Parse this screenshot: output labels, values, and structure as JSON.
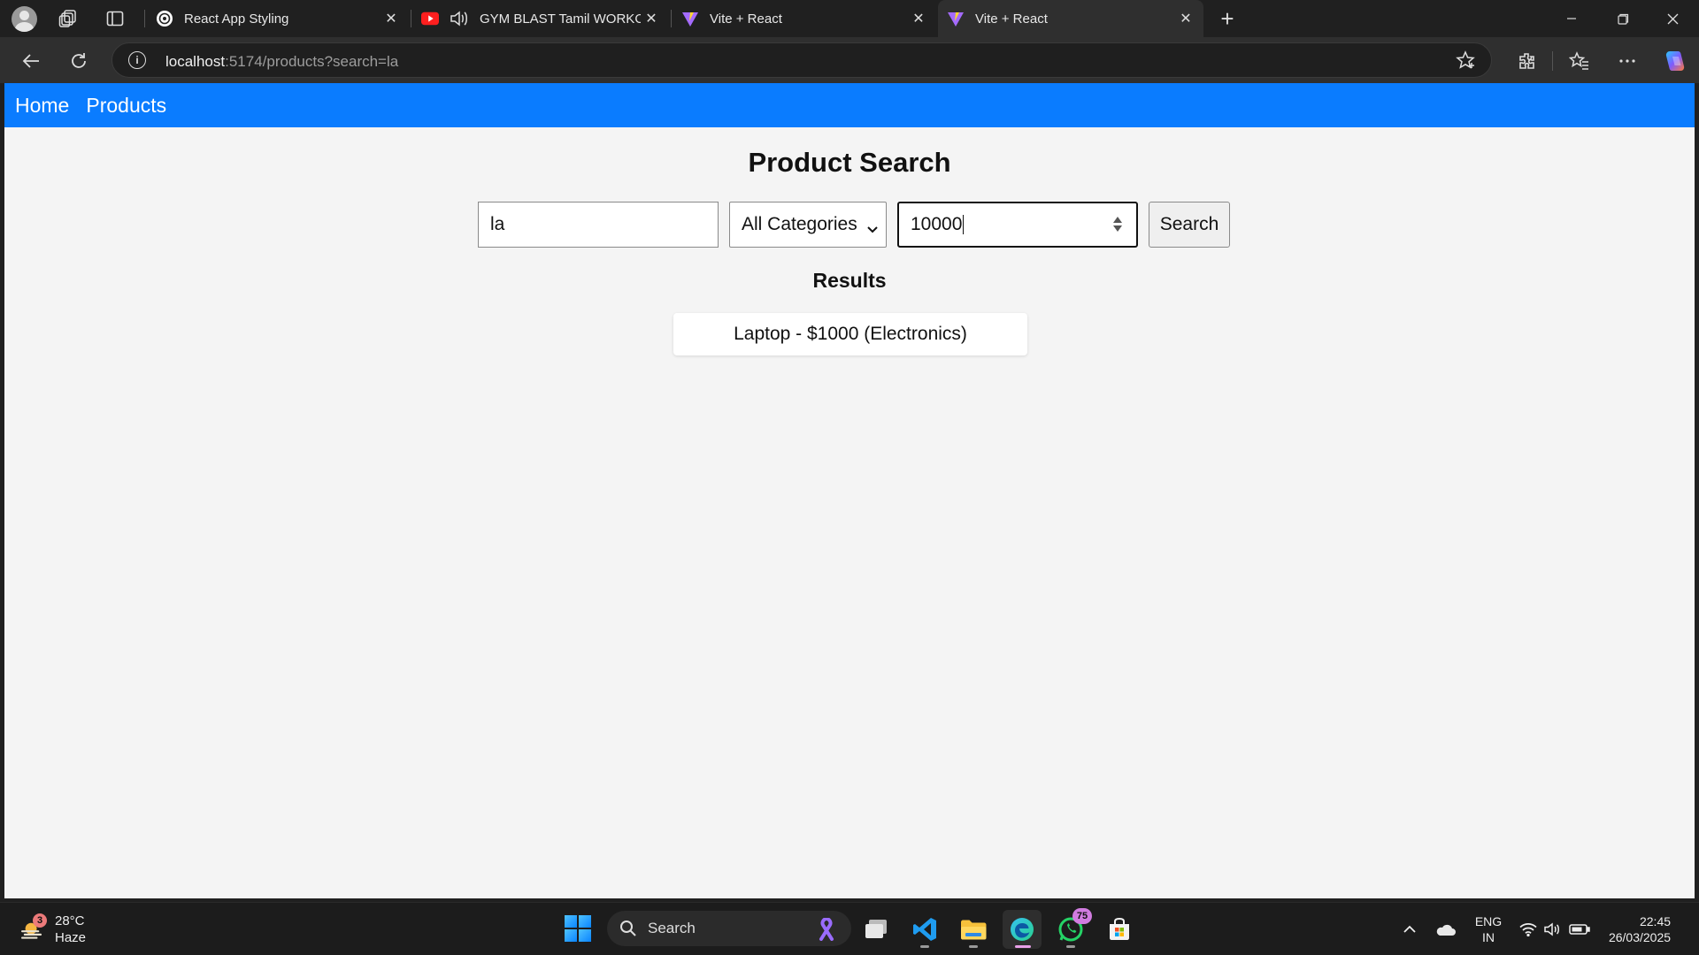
{
  "browser": {
    "tabs": [
      {
        "title": "React App Styling",
        "favicon": "openai-icon",
        "active": false
      },
      {
        "title": "GYM BLAST Tamil WORKOUT",
        "favicon": "youtube-icon",
        "audio": true,
        "active": false
      },
      {
        "title": "Vite + React",
        "favicon": "vite-icon",
        "active": false
      },
      {
        "title": "Vite + React",
        "favicon": "vite-icon",
        "active": true
      }
    ],
    "url_host": "localhost",
    "url_rest": ":5174/products?search=la"
  },
  "nav": {
    "home": "Home",
    "products": "Products"
  },
  "page": {
    "title": "Product Search",
    "search_value": "la",
    "category_value": "All Categories",
    "max_price_value": "10000",
    "search_button": "Search",
    "results_title": "Results",
    "results": [
      "Laptop - $1000 (Electronics)"
    ]
  },
  "taskbar": {
    "weather_badge": "3",
    "temperature": "28°C",
    "condition": "Haze",
    "search_label": "Search",
    "whatsapp_badge": "75",
    "lang_top": "ENG",
    "lang_bottom": "IN",
    "time": "22:45",
    "date": "26/03/2025"
  },
  "colors": {
    "navbar": "#0a7cff",
    "page_bg": "#f4f4f4",
    "browser_dark": "#202020"
  }
}
